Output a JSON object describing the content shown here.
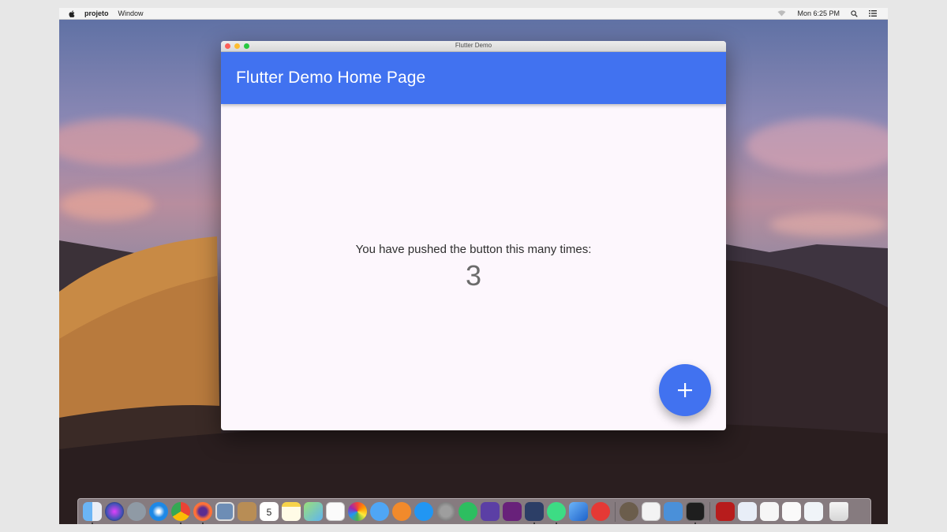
{
  "menubar": {
    "app_name": "projeto",
    "window_menu": "Window",
    "clock": "Mon 6:25 PM"
  },
  "window": {
    "title": "Flutter Demo",
    "appbar_title": "Flutter Demo Home Page",
    "message": "You have pushed the button this many times:",
    "counter": "3",
    "fab_label": "+"
  },
  "colors": {
    "primary": "#4172f0",
    "window_bg": "#fdf7fd"
  },
  "icons": {
    "menubar_right": [
      "wifi-icon",
      "spotlight-search-icon",
      "control-list-icon"
    ],
    "dock": [
      "finder-icon",
      "siri-icon",
      "launchpad-icon",
      "safari-icon",
      "chrome-icon",
      "firefox-icon",
      "preview-icon",
      "contacts-icon",
      "calendar-icon",
      "notes-icon",
      "maps-icon",
      "reminders-icon",
      "photos-icon",
      "messages-icon",
      "books-icon",
      "app-store-icon",
      "system-preferences-icon",
      "evernote-icon",
      "dropbox-icon",
      "visual-studio-icon",
      "vscode-icon",
      "android-studio-icon",
      "xcode-icon",
      "news-icon",
      "gimp-icon",
      "textedit-icon",
      "simulator-icon",
      "terminal-icon",
      "acrobat-icon",
      "jira-doc-icon",
      "document-thumbnail-icon",
      "document-thumbnail-icon",
      "document-thumbnail-icon",
      "trash-icon"
    ]
  },
  "dock": {
    "calendar_month": "NOV",
    "calendar_day": "5"
  }
}
